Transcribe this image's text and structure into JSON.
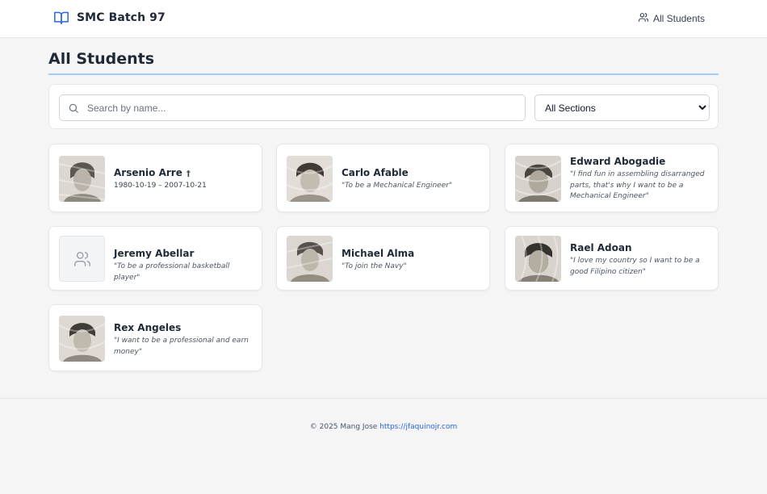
{
  "header": {
    "brand_title": "SMC Batch 97",
    "brand_icon": "book-open-icon",
    "nav_link_label": "All Students",
    "nav_icon": "users-icon"
  },
  "page": {
    "title": "All Students",
    "accent_color": "#93c5fd"
  },
  "filters": {
    "search_placeholder": "Search by name...",
    "search_value": "",
    "section_selected": "All Sections"
  },
  "students": [
    {
      "name": "Arsenio Arre",
      "deceased_mark": "†",
      "dates": "1980-10-19 – 2007-10-21",
      "quote": ""
    },
    {
      "name": "Carlo Afable",
      "quote": "\"To be a Mechanical Engineer\""
    },
    {
      "name": "Edward Abogadie",
      "quote": "\"I find fun in assembling disarranged parts, that's why I want to be a Mechanical Engineer\""
    },
    {
      "name": "Jeremy Abellar",
      "quote": "\"To be a professional basketball player\"",
      "photo": "placeholder-users-icon"
    },
    {
      "name": "Michael Alma",
      "quote": "\"To join the Navy\""
    },
    {
      "name": "Rael Adoan",
      "quote": "\"I love my country so I want to be a good Filipino citizen\""
    },
    {
      "name": "Rex Angeles",
      "quote": "\"I want to be a professional and earn money\""
    }
  ],
  "footer": {
    "copyright": "© 2025 Mang Jose",
    "link_text": "https://jfaquinojr.com",
    "link_color": "#2563eb"
  }
}
